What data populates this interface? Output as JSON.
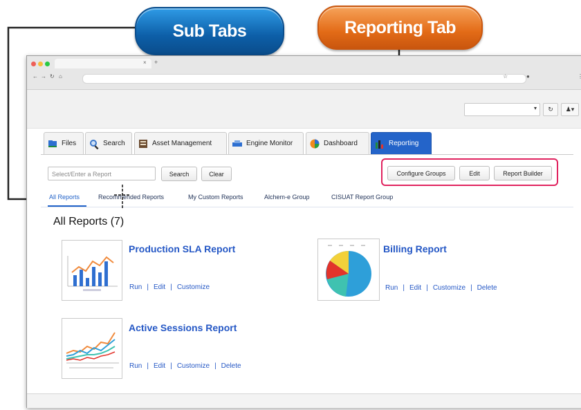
{
  "callouts": {
    "sub_tabs": "Sub Tabs",
    "reporting_tab": "Reporting Tab"
  },
  "main_tabs": [
    {
      "label": "Files",
      "icon": "files-icon"
    },
    {
      "label": "Search",
      "icon": "search-icon"
    },
    {
      "label": "Asset Management",
      "icon": "asset-icon"
    },
    {
      "label": "Engine Monitor",
      "icon": "engine-icon"
    },
    {
      "label": "Dashboard",
      "icon": "dashboard-icon"
    },
    {
      "label": "Reporting",
      "icon": "reporting-icon",
      "active": true
    }
  ],
  "search": {
    "placeholder": "Select/Enter a Report",
    "search_label": "Search",
    "clear_label": "Clear"
  },
  "actions": {
    "configure_groups": "Configure Groups",
    "edit": "Edit",
    "report_builder": "Report Builder"
  },
  "sub_tabs": [
    {
      "label": "All Reports",
      "active": true
    },
    {
      "label": "Recommended Reports"
    },
    {
      "label": "My Custom Reports"
    },
    {
      "label": "Alchem-e Group"
    },
    {
      "label": "CISUAT Report Group"
    }
  ],
  "section_title": "All Reports (7)",
  "reports": [
    {
      "title": "Production SLA Report",
      "links": [
        "Run",
        "Edit",
        "Customize"
      ]
    },
    {
      "title": "Billing Report",
      "links": [
        "Run",
        "Edit",
        "Customize",
        "Delete"
      ]
    },
    {
      "title": "Active Sessions Report",
      "links": [
        "Run",
        "Edit",
        "Customize",
        "Delete"
      ]
    }
  ],
  "colors": {
    "accent_blue": "#2464c9",
    "highlight_pink": "#e0225e",
    "callout_blue": "#0d5fa8",
    "callout_orange": "#e36b17",
    "link_blue": "#2457c5"
  }
}
